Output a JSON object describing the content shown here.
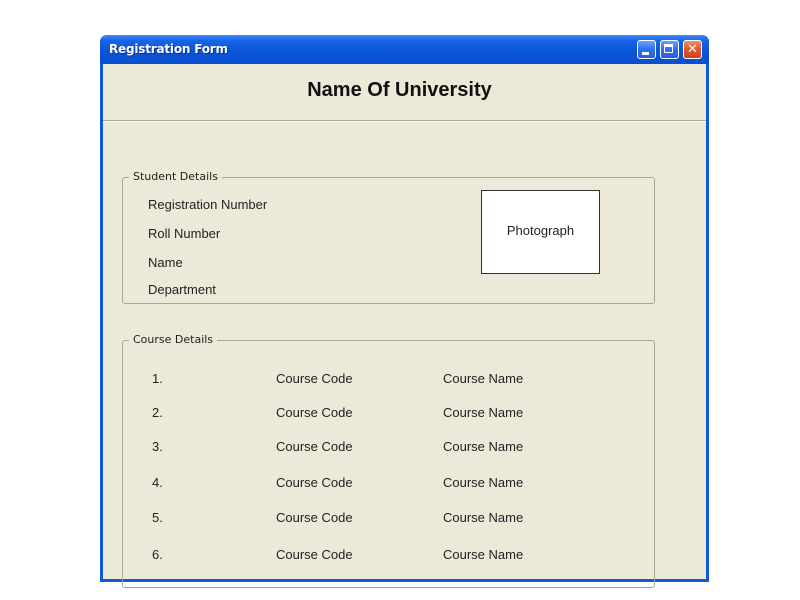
{
  "window": {
    "title": "Registration Form",
    "controls": [
      "minimize-icon",
      "maximize-icon",
      "close-icon"
    ],
    "close_glyph": "✕"
  },
  "header": {
    "title": "Name Of University"
  },
  "student_details": {
    "legend": "Student Details",
    "fields": [
      "Registration Number",
      "Roll Number",
      "Name",
      "Department"
    ],
    "photo_label": "Photograph"
  },
  "course_details": {
    "legend": "Course Details",
    "rows": [
      {
        "num": "1.",
        "code": "Course Code",
        "name": "Course Name"
      },
      {
        "num": "2.",
        "code": "Course Code",
        "name": "Course Name"
      },
      {
        "num": "3.",
        "code": "Course Code",
        "name": "Course Name"
      },
      {
        "num": "4.",
        "code": "Course Code",
        "name": "Course Name"
      },
      {
        "num": "5.",
        "code": "Course Code",
        "name": "Course Name"
      },
      {
        "num": "6.",
        "code": "Course Code",
        "name": "Course Name"
      }
    ]
  },
  "colors": {
    "titlebar": "#0a55d8",
    "client_background": "#ece9d8",
    "close_button": "#e0562f"
  }
}
